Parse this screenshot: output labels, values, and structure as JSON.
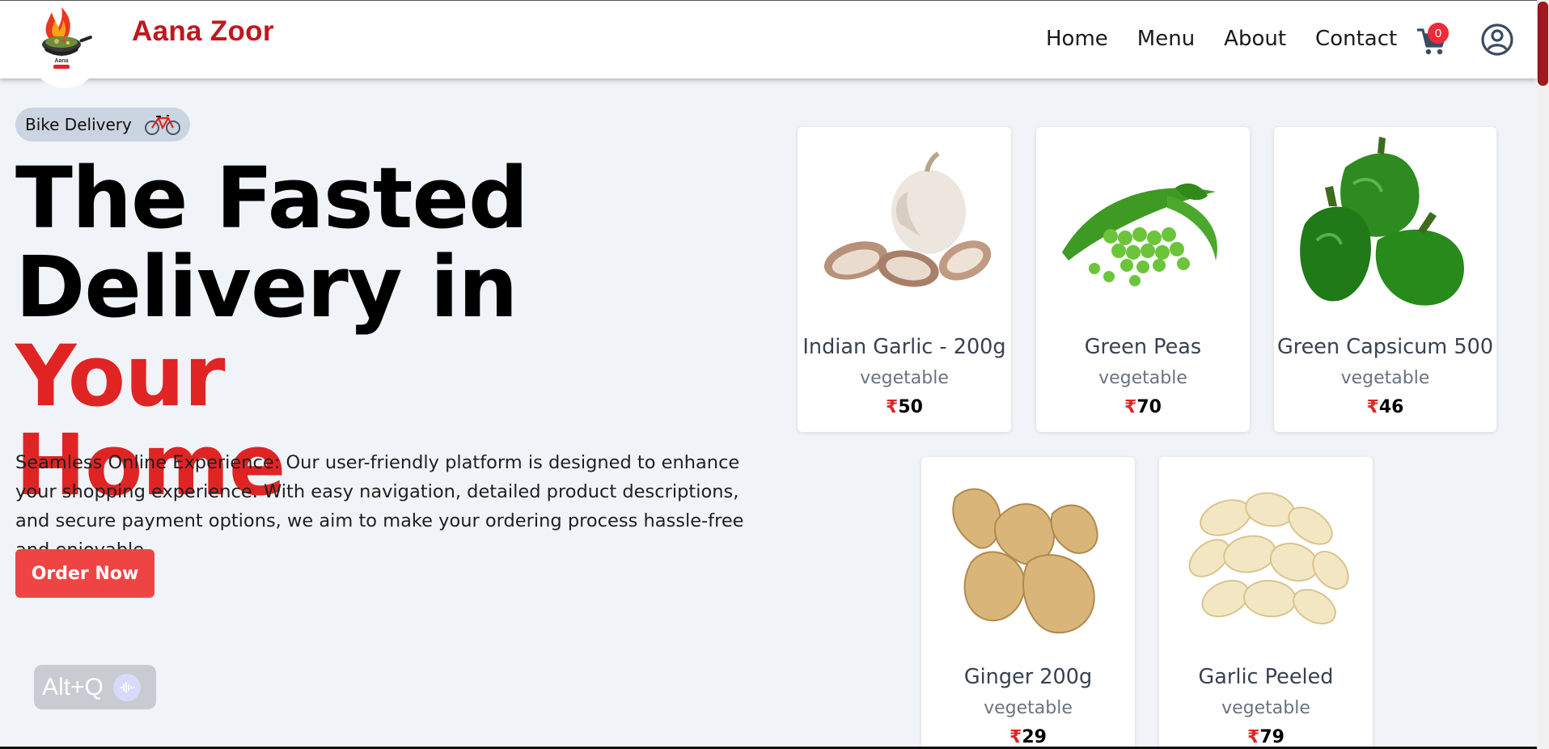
{
  "header": {
    "brand": "Aana Zoor",
    "nav": [
      {
        "label": "Home"
      },
      {
        "label": "Menu"
      },
      {
        "label": "About"
      },
      {
        "label": "Contact"
      }
    ],
    "cart_count": "0",
    "colors": {
      "brand": "#c0181d",
      "accent": "#ef4444",
      "badge": "#ef2b3a"
    }
  },
  "hero": {
    "badge": "Bike Delivery",
    "headline_line1": "The Fasted",
    "headline_line2a": "Delivery in ",
    "headline_line2b": "Your",
    "headline_line3": "Home",
    "description": "Seamless Online Experience: Our user-friendly platform is designed to enhance your shopping experience. With easy navigation, detailed product descriptions, and secure payment options, we aim to make your ordering process hassle-free and enjoyable.",
    "order_button": "Order Now"
  },
  "assistant": {
    "shortcut": "Alt+Q"
  },
  "products": [
    {
      "name": "Indian Garlic - 200g",
      "category": "vegetable",
      "currency": "₹",
      "price": "50",
      "icon": "garlic-image"
    },
    {
      "name": "Green Peas",
      "category": "vegetable",
      "currency": "₹",
      "price": "70",
      "icon": "peas-image"
    },
    {
      "name": "Green Capsicum 500",
      "category": "vegetable",
      "currency": "₹",
      "price": "46",
      "icon": "capsicum-image"
    },
    {
      "name": "Ginger 200g",
      "category": "vegetable",
      "currency": "₹",
      "price": "29",
      "icon": "ginger-image"
    },
    {
      "name": "Garlic Peeled",
      "category": "vegetable",
      "currency": "₹",
      "price": "79",
      "icon": "peeled-garlic-image"
    }
  ]
}
